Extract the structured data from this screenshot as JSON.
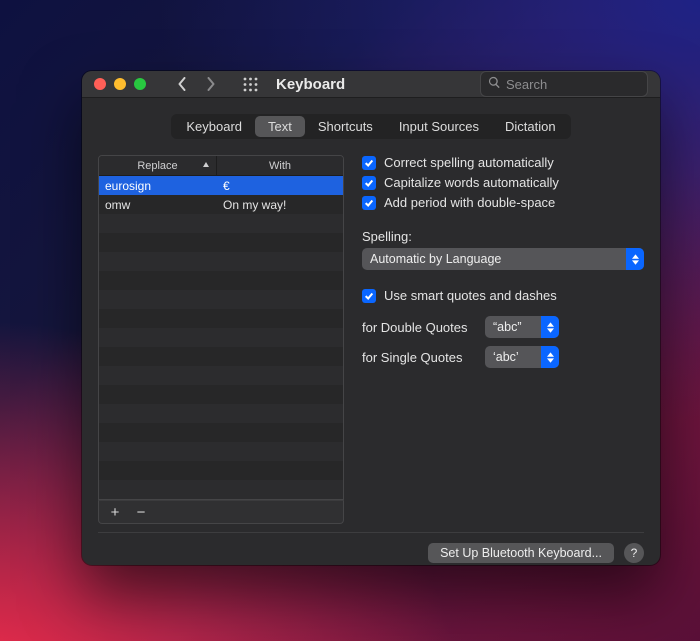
{
  "window": {
    "title": "Keyboard"
  },
  "search": {
    "placeholder": "Search"
  },
  "tabs": [
    "Keyboard",
    "Text",
    "Shortcuts",
    "Input Sources",
    "Dictation"
  ],
  "active_tab_index": 1,
  "table": {
    "columns": {
      "replace": "Replace",
      "with": "With"
    },
    "rows": [
      {
        "replace": "eurosign",
        "with": "€",
        "selected": true
      },
      {
        "replace": "omw",
        "with": "On my way!",
        "selected": false
      }
    ],
    "blank_rows": 15
  },
  "options": {
    "correct_spelling": {
      "label": "Correct spelling automatically",
      "checked": true
    },
    "capitalize": {
      "label": "Capitalize words automatically",
      "checked": true
    },
    "double_space_period": {
      "label": "Add period with double-space",
      "checked": true
    },
    "spelling_label": "Spelling:",
    "spelling_value": "Automatic by Language",
    "smart_quotes": {
      "label": "Use smart quotes and dashes",
      "checked": true
    },
    "double_quotes_label": "for Double Quotes",
    "double_quotes_value": "“abc”",
    "single_quotes_label": "for Single Quotes",
    "single_quotes_value": "‘abc’"
  },
  "footer": {
    "bluetooth_button": "Set Up Bluetooth Keyboard...",
    "help": "?"
  },
  "icons": {
    "add": "+",
    "remove": "−"
  }
}
